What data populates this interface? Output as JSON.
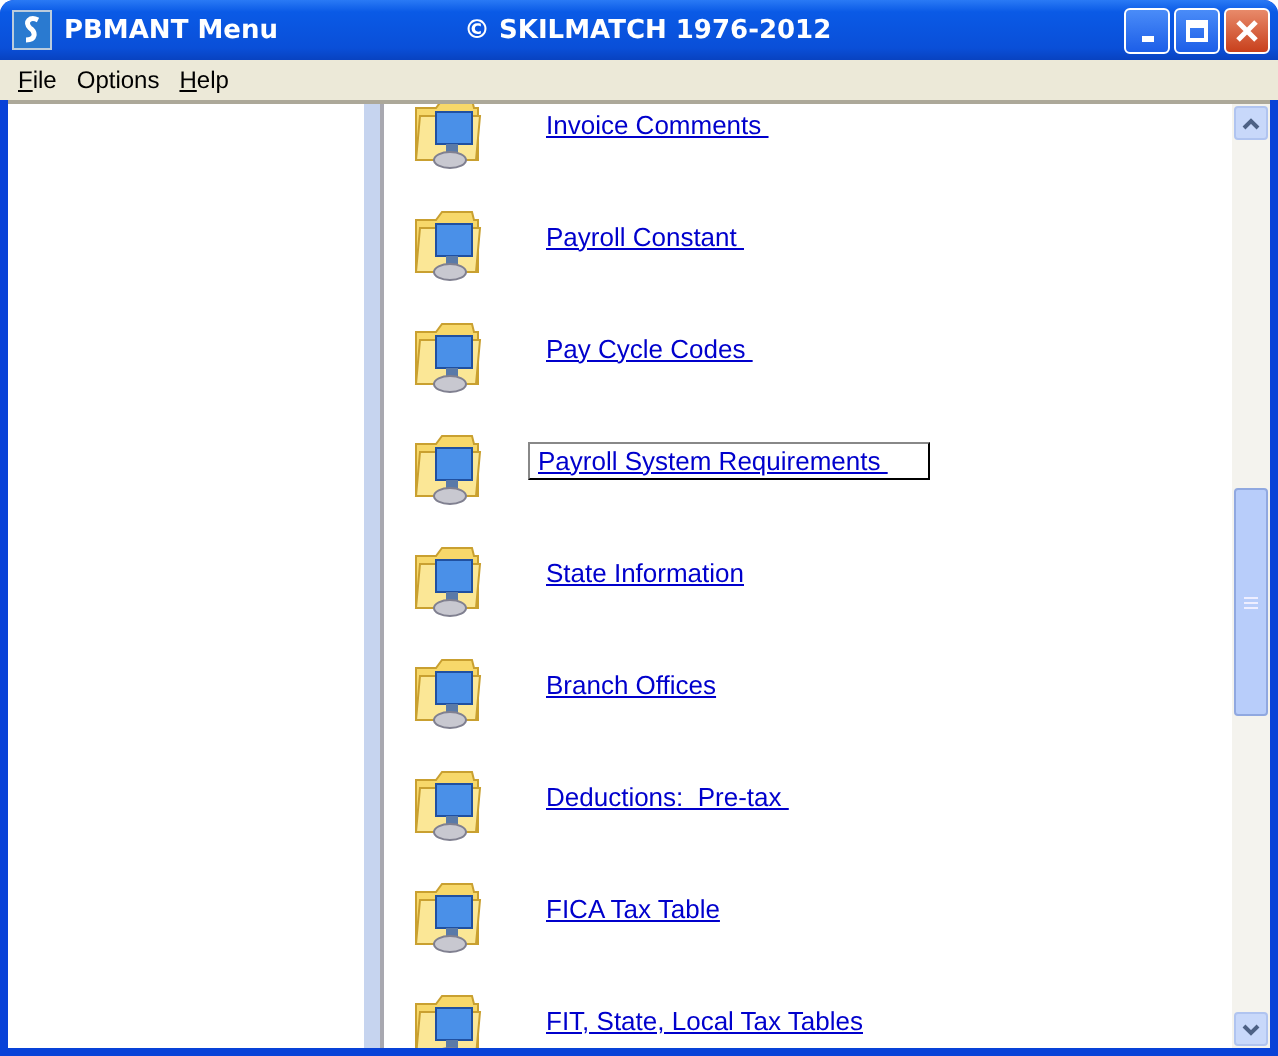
{
  "window": {
    "title": "PBMANT Menu",
    "copyright": "© SKILMATCH 1976-2012"
  },
  "menu": [
    {
      "label": "File",
      "underlined_initial": true
    },
    {
      "label": "Options",
      "underlined_initial": false
    },
    {
      "label": "Help",
      "underlined_initial": true
    }
  ],
  "items": [
    {
      "label": "Invoice Comments ",
      "selected": false
    },
    {
      "label": "Payroll Constant ",
      "selected": false
    },
    {
      "label": "Pay Cycle Codes ",
      "selected": false
    },
    {
      "label": "Payroll System Requirements ",
      "selected": true
    },
    {
      "label": "State Information",
      "selected": false
    },
    {
      "label": "Branch Offices",
      "selected": false
    },
    {
      "label": "Deductions:  Pre-tax ",
      "selected": false
    },
    {
      "label": "FICA Tax Table",
      "selected": false
    },
    {
      "label": "FIT, State, Local Tax Tables",
      "selected": false
    }
  ]
}
